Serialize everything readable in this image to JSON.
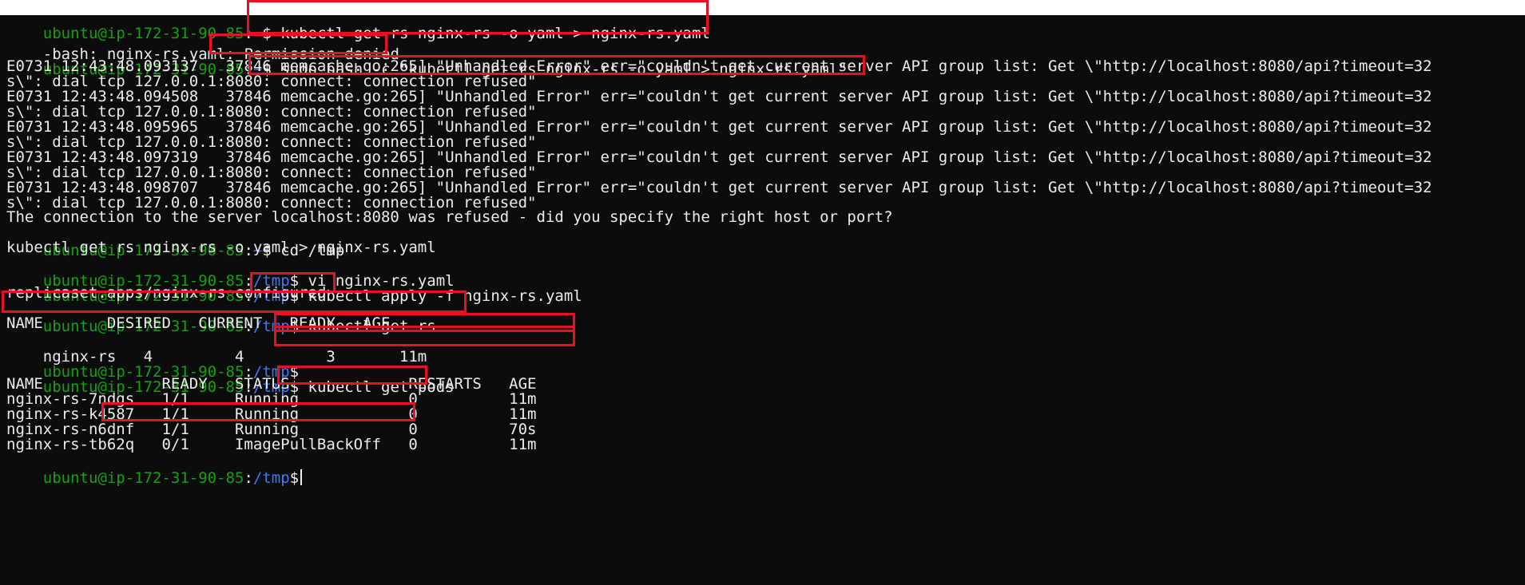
{
  "prompt": {
    "user_host": "ubuntu@ip-172-31-90-85",
    "home_dir": "~",
    "tmp_dir": "/tmp",
    "separator": ":",
    "symbol": "$"
  },
  "colors": {
    "prompt_user": "#13a10e",
    "prompt_path": "#3b78ff",
    "text": "#ececec",
    "background": "#0c0c0c",
    "highlight": "#e81123"
  },
  "lines": {
    "l0": " kubectl get rs nginx-rs -o yaml > nginx-rs.yaml",
    "l1a": "-bash: nginx-rs.yaml: ",
    "l1b": "Permission denied",
    "l2": " sudo bash -c \"kubectl get rs nginx-rs -o yaml > nginx-rs.yaml\"",
    "l3": "E0731 12:43:48.093137   37846 memcache.go:265] \"Unhandled Error\" err=\"couldn't get current server API group list: Get \\\"http://localhost:8080/api?timeout=32",
    "l4": "s\\\": dial tcp 127.0.0.1:8080: connect: connection refused\"",
    "l5": "E0731 12:43:48.094508   37846 memcache.go:265] \"Unhandled Error\" err=\"couldn't get current server API group list: Get \\\"http://localhost:8080/api?timeout=32",
    "l6": "s\\\": dial tcp 127.0.0.1:8080: connect: connection refused\"",
    "l7": "E0731 12:43:48.095965   37846 memcache.go:265] \"Unhandled Error\" err=\"couldn't get current server API group list: Get \\\"http://localhost:8080/api?timeout=32",
    "l8": "s\\\": dial tcp 127.0.0.1:8080: connect: connection refused\"",
    "l9": "E0731 12:43:48.097319   37846 memcache.go:265] \"Unhandled Error\" err=\"couldn't get current server API group list: Get \\\"http://localhost:8080/api?timeout=32",
    "l10": "s\\\": dial tcp 127.0.0.1:8080: connect: connection refused\"",
    "l11": "E0731 12:43:48.098707   37846 memcache.go:265] \"Unhandled Error\" err=\"couldn't get current server API group list: Get \\\"http://localhost:8080/api?timeout=32",
    "l12": "s\\\": dial tcp 127.0.0.1:8080: connect: connection refused\"",
    "l13": "The connection to the server localhost:8080 was refused - did you specify the right host or port?",
    "l14": " cd /tmp",
    "l15": "kubectl get rs nginx-rs -o yaml > nginx-rs.yaml",
    "l16": " vi nginx-rs.yaml",
    "l17": " kubectl apply -f nginx-rs.yaml",
    "l18": "replicaset.apps/nginx-rs configured",
    "l19": " kubectl get rs",
    "l20": "NAME       DESIRED   CURRENT   READY   AGE",
    "l21a": "nginx-rs  ",
    "l21b": " 4         4         3       11m",
    "l23": " kubectl get pods",
    "l24": "NAME             READY   STATUS             RESTARTS   AGE",
    "l25": "nginx-rs-7ndgs   1/1     Running            0          11m",
    "l26": "nginx-rs-k4587   1/1     Running            0          11m",
    "l27": "nginx-rs-n6dnf   1/1     Running            0          70s",
    "l28": "nginx-rs-tb62q   0/1     ImagePullBackOff   0          11m"
  }
}
